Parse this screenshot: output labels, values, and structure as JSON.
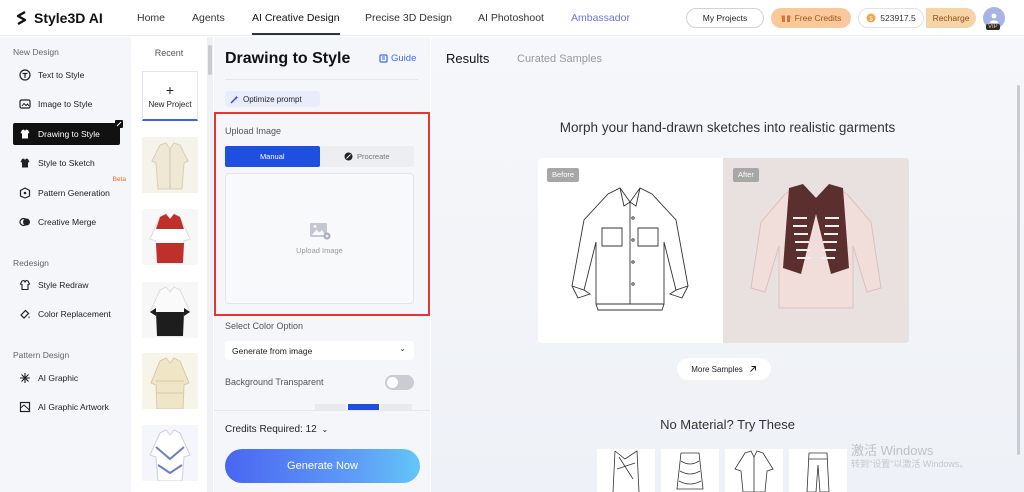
{
  "brand": {
    "name": "Style3D AI"
  },
  "nav": {
    "items": [
      {
        "label": "Home"
      },
      {
        "label": "Agents"
      },
      {
        "label": "AI Creative Design"
      },
      {
        "label": "Precise 3D Design"
      },
      {
        "label": "AI Photoshoot"
      },
      {
        "label": "Ambassador"
      }
    ],
    "my_projects": "My Projects",
    "free_credits": "Free Credits",
    "credits_balance": "523917.5",
    "recharge": "Recharge",
    "vip": "VIP"
  },
  "sidebar": {
    "sections": [
      {
        "title": "New Design",
        "items": [
          {
            "label": "Text to Style",
            "icon": "text-to-style-icon"
          },
          {
            "label": "Image to Style",
            "icon": "image-to-style-icon"
          },
          {
            "label": "Drawing to Style",
            "icon": "drawing-to-style-icon",
            "active": true
          },
          {
            "label": "Style to Sketch",
            "icon": "style-to-sketch-icon"
          },
          {
            "label": "Pattern Generation",
            "icon": "pattern-generation-icon",
            "badge": "Beta"
          },
          {
            "label": "Creative Merge",
            "icon": "creative-merge-icon"
          }
        ]
      },
      {
        "title": "Redesign",
        "items": [
          {
            "label": "Style Redraw",
            "icon": "style-redraw-icon"
          },
          {
            "label": "Color Replacement",
            "icon": "color-replacement-icon"
          }
        ]
      },
      {
        "title": "Pattern Design",
        "items": [
          {
            "label": "AI Graphic",
            "icon": "ai-graphic-icon"
          },
          {
            "label": "AI Graphic Artwork",
            "icon": "ai-graphic-artwork-icon"
          }
        ]
      }
    ]
  },
  "recent": {
    "title": "Recent",
    "new_project": "New Project",
    "thumbnails": [
      {
        "name": "cream-jacket-thumbnail"
      },
      {
        "name": "red-white-jacket-thumbnail"
      },
      {
        "name": "black-white-jacket-thumbnail"
      },
      {
        "name": "cream-parka-thumbnail"
      },
      {
        "name": "blue-white-jacket-thumbnail"
      }
    ]
  },
  "panel": {
    "title": "Drawing to Style",
    "guide": "Guide",
    "optimize_prompt": "Optimize prompt",
    "upload_label": "Upload Image",
    "modes": [
      {
        "label": "Manual",
        "selected": true
      },
      {
        "label": "Procreate",
        "selected": false
      }
    ],
    "dropzone_label": "Upload Image",
    "color_option_label": "Select Color Option",
    "color_option_value": "Generate from image",
    "bg_transparent_label": "Background Transparent",
    "bg_transparent_on": false,
    "credits_required": "Credits Required: 12",
    "generate": "Generate Now"
  },
  "results": {
    "tabs": [
      {
        "label": "Results",
        "active": true
      },
      {
        "label": "Curated Samples",
        "active": false
      }
    ],
    "headline": "Morph your hand-drawn sketches into realistic garments",
    "before_tag": "Before",
    "after_tag": "After",
    "more_samples": "More Samples",
    "no_material": "No Material? Try These"
  },
  "watermark": {
    "line1": "激活 Windows",
    "line2": "转到\"设置\"以激活 Windows。"
  },
  "colors": {
    "accent": "#1f4fe0",
    "highlight_box": "#e53535",
    "brand_gold": "#f9c99b"
  }
}
